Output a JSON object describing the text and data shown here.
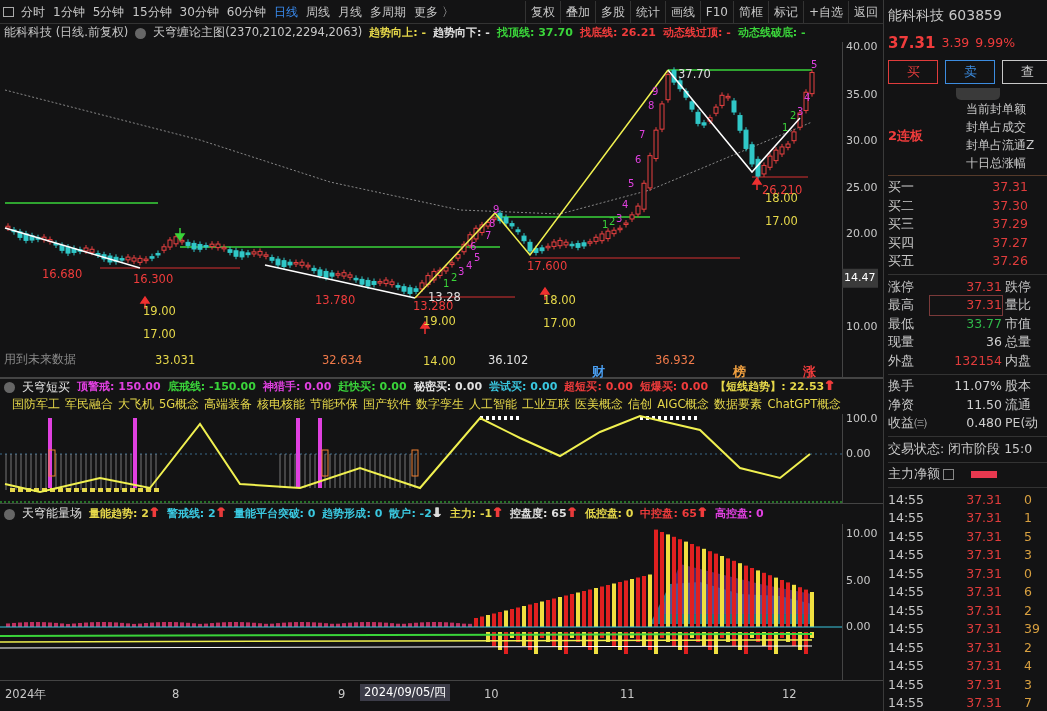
{
  "toolbar": {
    "periods": [
      {
        "label": "分时",
        "selected": false
      },
      {
        "label": "1分钟",
        "selected": false
      },
      {
        "label": "5分钟",
        "selected": false
      },
      {
        "label": "15分钟",
        "selected": false
      },
      {
        "label": "30分钟",
        "selected": false
      },
      {
        "label": "60分钟",
        "selected": false
      },
      {
        "label": "日线",
        "selected": true
      },
      {
        "label": "周线",
        "selected": false
      },
      {
        "label": "月线",
        "selected": false
      },
      {
        "label": "多周期",
        "selected": false
      },
      {
        "label": "更多 〉",
        "selected": false
      }
    ],
    "tools": [
      "复权",
      "叠加",
      "多股",
      "统计",
      "画线",
      "F10",
      "简框",
      "标记",
      "+自选",
      "返回"
    ]
  },
  "main_chart": {
    "title": "能科科技 (日线.前复权)",
    "indicator": "天穹缠论主图(2370,2102,2294,2063)",
    "params": [
      {
        "label": "趋势向上: -",
        "color": "#e6d84a"
      },
      {
        "label": "趋势向下: -",
        "color": "#e0e0e0"
      },
      {
        "label": "找顶线: 37.70",
        "color": "#3ad43a"
      },
      {
        "label": "找底线: 26.21",
        "color": "#f03c3c"
      },
      {
        "label": "动态线过顶: -",
        "color": "#f03c3c"
      },
      {
        "label": "动态线破底: -",
        "color": "#3ad43a"
      }
    ],
    "yticks": [
      "40.00",
      "35.00",
      "30.00",
      "25.00",
      "20.00",
      "10.00"
    ],
    "current_price": "14.47",
    "labels": [
      {
        "text": "16.680",
        "color": "#f03c3c"
      },
      {
        "text": "16.300",
        "color": "#f03c3c"
      },
      {
        "text": "19.00",
        "color": "#e6d84a"
      },
      {
        "text": "17.00",
        "color": "#e6d84a"
      },
      {
        "text": "13.780",
        "color": "#f03c3c"
      },
      {
        "text": "13.28",
        "color": "#e0e0e0"
      },
      {
        "text": "13.280",
        "color": "#f03c3c"
      },
      {
        "text": "19.00",
        "color": "#e6d84a"
      },
      {
        "text": "14.00",
        "color": "#e6d84a"
      },
      {
        "text": "17.600",
        "color": "#f03c3c"
      },
      {
        "text": "18.00",
        "color": "#e6d84a"
      },
      {
        "text": "17.00",
        "color": "#e6d84a"
      },
      {
        "text": "37.70",
        "color": "#e0e0e0"
      },
      {
        "text": "26.210",
        "color": "#f03c3c"
      },
      {
        "text": "18.00",
        "color": "#e6d84a"
      },
      {
        "text": "17.00",
        "color": "#e6d84a"
      },
      {
        "text": "用到未来数据",
        "color": "#8a8a8a"
      },
      {
        "text": "33.031",
        "color": "#e6d84a"
      },
      {
        "text": "32.634",
        "color": "#f07a4a"
      },
      {
        "text": "36.102",
        "color": "#e0e0e0"
      },
      {
        "text": "36.932",
        "color": "#f07a4a"
      },
      {
        "text": "财",
        "color": "#4a9ef0"
      },
      {
        "text": "榜",
        "color": "#f0a040"
      },
      {
        "text": "涨",
        "color": "#f03c3c"
      }
    ],
    "counts": [
      {
        "text": "1",
        "color": "#3ad43a"
      },
      {
        "text": "2",
        "color": "#3ad43a"
      },
      {
        "text": "3",
        "color": "#e040e0"
      },
      {
        "text": "4",
        "color": "#e040e0"
      },
      {
        "text": "5",
        "color": "#e040e0"
      },
      {
        "text": "6",
        "color": "#e040e0"
      },
      {
        "text": "7",
        "color": "#e040e0"
      },
      {
        "text": "8",
        "color": "#e040e0"
      },
      {
        "text": "9",
        "color": "#e040e0"
      },
      {
        "text": "1",
        "color": "#3ad43a"
      },
      {
        "text": "2",
        "color": "#3ad43a"
      },
      {
        "text": "3",
        "color": "#e040e0"
      },
      {
        "text": "4",
        "color": "#e040e0"
      },
      {
        "text": "5",
        "color": "#e040e0"
      },
      {
        "text": "6",
        "color": "#e040e0"
      },
      {
        "text": "7",
        "color": "#e040e0"
      },
      {
        "text": "8",
        "color": "#e040e0"
      },
      {
        "text": "9",
        "color": "#e040e0"
      },
      {
        "text": "1",
        "color": "#3ad43a"
      },
      {
        "text": "2",
        "color": "#3ad43a"
      },
      {
        "text": "3",
        "color": "#e040e0"
      },
      {
        "text": "4",
        "color": "#e040e0"
      },
      {
        "text": "5",
        "color": "#e040e0"
      }
    ]
  },
  "short_buy": {
    "name": "天穹短买",
    "params": [
      {
        "label": "顶警戒: 150.00",
        "color": "#e040e0"
      },
      {
        "label": "底戒线: -150.00",
        "color": "#3ad43a"
      },
      {
        "label": "神猎手: 0.00",
        "color": "#e040e0"
      },
      {
        "label": "赶快买: 0.00",
        "color": "#3ad43a"
      },
      {
        "label": "秘密买: 0.00",
        "color": "#e0e0e0"
      },
      {
        "label": "尝试买: 0.00",
        "color": "#3ac8e0"
      },
      {
        "label": "超短买: 0.00",
        "color": "#f03c3c"
      },
      {
        "label": "短爆买: 0.00",
        "color": "#f03c3c"
      },
      {
        "label": "【短线趋势】: 22.53",
        "color": "#e6d84a",
        "arrow": {
          "symbol": "↑",
          "color": "#f03c3c"
        }
      }
    ],
    "tags": [
      "国防军工",
      "军民融合",
      "大飞机",
      "5G概念",
      "高端装备",
      "核电核能",
      "节能环保",
      "国产软件",
      "数字孪生",
      "人工智能",
      "工业互联",
      "医美概念",
      "信创",
      "AIGC概念",
      "数据要素",
      "ChatGPT概念"
    ],
    "yticks": [
      "100.0",
      "0.00"
    ]
  },
  "energy_field": {
    "name": "天穹能量场",
    "params": [
      {
        "label": "量能趋势: 2",
        "color": "#e6d84a",
        "arrow": {
          "symbol": "↑",
          "color": "#f03c3c"
        }
      },
      {
        "label": "警戒线: 2",
        "color": "#3ac8e0",
        "arrow": {
          "symbol": "↑",
          "color": "#f03c3c"
        }
      },
      {
        "label": "量能平台突破: 0",
        "color": "#3ac8e0"
      },
      {
        "label": "趋势形成: 0",
        "color": "#3ac8e0"
      },
      {
        "label": "散户: -2",
        "color": "#3ac8e0",
        "arrow": {
          "symbol": "↓",
          "color": "#e0e0e0"
        }
      },
      {
        "label": "主力: -1",
        "color": "#e6d84a",
        "arrow": {
          "symbol": "↑",
          "color": "#f03c3c"
        }
      },
      {
        "label": "控盘度: 65",
        "color": "#e0e0e0",
        "arrow": {
          "symbol": "↑",
          "color": "#f03c3c"
        }
      },
      {
        "label": "低控盘: 0",
        "color": "#e6d84a"
      },
      {
        "label": "中控盘: 65",
        "color": "#f03c3c",
        "arrow": {
          "symbol": "↑",
          "color": "#f03c3c"
        }
      },
      {
        "label": "高控盘: 0",
        "color": "#e040e0"
      }
    ],
    "yticks": [
      "10.00",
      "5.00",
      "0.00"
    ]
  },
  "x_axis": {
    "labels": [
      "2024年",
      "8",
      "9",
      "10",
      "11",
      "12"
    ],
    "cursor_date": "2024/09/05/四"
  },
  "quote": {
    "name": "能科科技",
    "code": "603859",
    "price": "37.31",
    "change": "3.39",
    "percent": "9.99%",
    "buttons": [
      {
        "label": "买",
        "color": "#e03c3c"
      },
      {
        "label": "卖",
        "color": "#3c8ce0"
      },
      {
        "label": "查",
        "color": "#c8c8c8"
      }
    ],
    "streak": "2连板",
    "seal_labels": [
      "当前封单额",
      "封单占成交",
      "封单占流通Z",
      "十日总涨幅"
    ],
    "bids": [
      {
        "label": "买一",
        "price": "37.31"
      },
      {
        "label": "买二",
        "price": "37.30"
      },
      {
        "label": "买三",
        "price": "37.29"
      },
      {
        "label": "买四",
        "price": "37.27"
      },
      {
        "label": "买五",
        "price": "37.26"
      }
    ],
    "stats": [
      {
        "label": "涨停",
        "value": "37.31",
        "color": "#e03c3c",
        "label2": "跌停"
      },
      {
        "label": "最高",
        "value": "37.31",
        "color": "#e03c3c",
        "label2": "量比",
        "boxed": true
      },
      {
        "label": "最低",
        "value": "33.77",
        "color": "#2fb84a",
        "label2": "市值"
      },
      {
        "label": "现量",
        "value": "36",
        "color": "#d0d0d0",
        "label2": "总量"
      },
      {
        "label": "外盘",
        "value": "132154",
        "color": "#e03c3c",
        "label2": "内盘"
      },
      {
        "label": "换手",
        "value": "11.07%",
        "color": "#d0d0d0",
        "label2": "股本"
      },
      {
        "label": "净资",
        "value": "11.50",
        "color": "#d0d0d0",
        "label2": "流通"
      },
      {
        "label": "收益㈢",
        "value": "0.480",
        "color": "#d0d0d0",
        "label2": "PE(动"
      }
    ],
    "trade_status": "交易状态: 闭市阶段 15:0",
    "main_net": "主力净额",
    "ticks": [
      {
        "time": "14:55",
        "price": "37.31",
        "volume": "0"
      },
      {
        "time": "14:55",
        "price": "37.31",
        "volume": "1"
      },
      {
        "time": "14:55",
        "price": "37.31",
        "volume": "5"
      },
      {
        "time": "14:55",
        "price": "37.31",
        "volume": "3"
      },
      {
        "time": "14:55",
        "price": "37.31",
        "volume": "0"
      },
      {
        "time": "14:55",
        "price": "37.31",
        "volume": "6"
      },
      {
        "time": "14:55",
        "price": "37.31",
        "volume": "2"
      },
      {
        "time": "14:55",
        "price": "37.31",
        "volume": "39"
      },
      {
        "time": "14:55",
        "price": "37.31",
        "volume": "2"
      },
      {
        "time": "14:55",
        "price": "37.31",
        "volume": "4"
      },
      {
        "time": "14:55",
        "price": "37.31",
        "volume": "3"
      },
      {
        "time": "14:55",
        "price": "37.31",
        "volume": "7"
      }
    ]
  }
}
